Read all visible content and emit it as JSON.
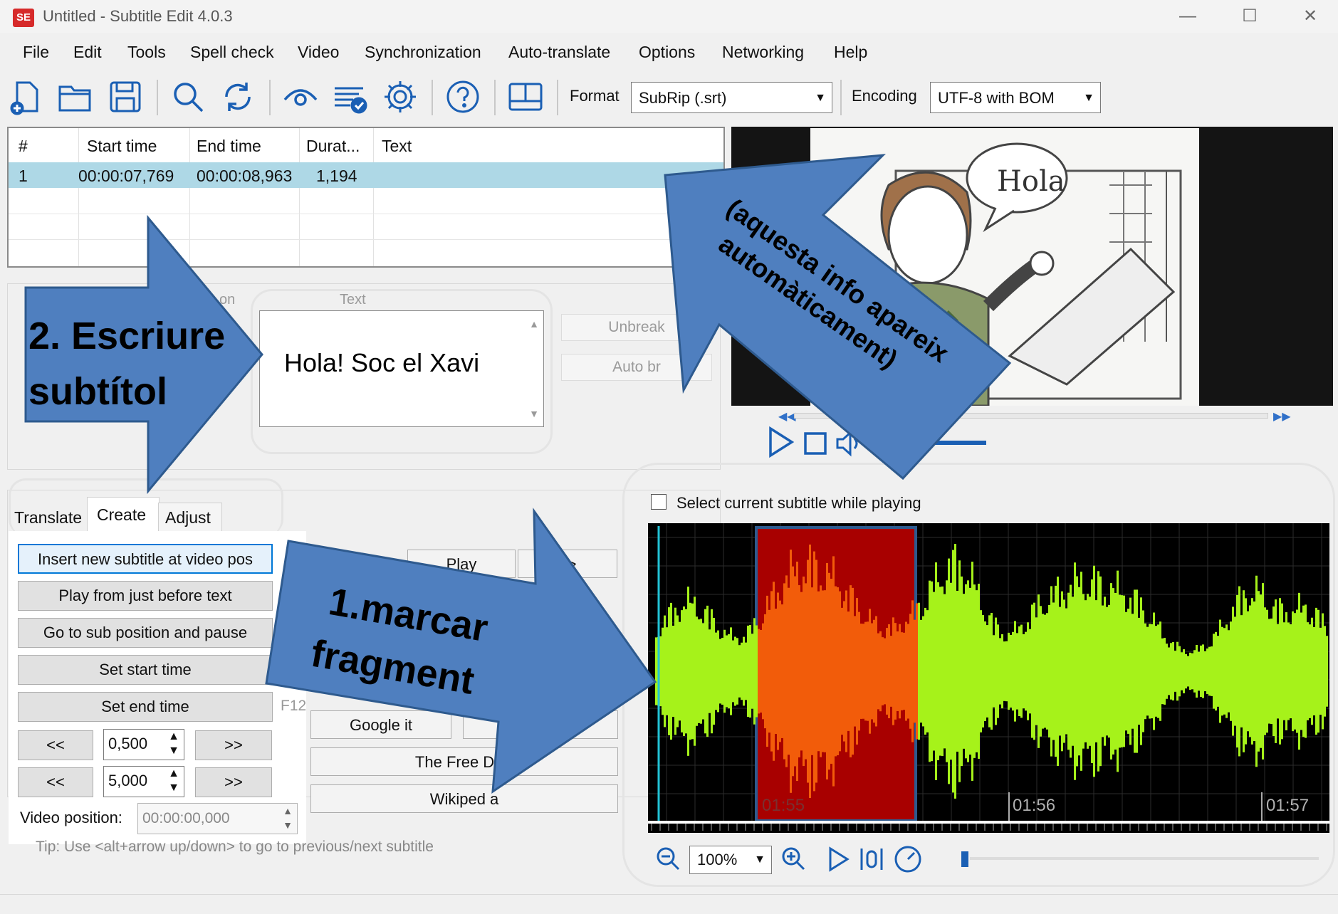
{
  "window": {
    "title": "Untitled - Subtitle Edit 4.0.3",
    "logo_text": "SE",
    "min_glyph": "—",
    "max_glyph": "☐",
    "close_glyph": "✕"
  },
  "menu": [
    "File",
    "Edit",
    "Tools",
    "Spell check",
    "Video",
    "Synchronization",
    "Auto-translate",
    "Options",
    "Networking",
    "Help"
  ],
  "toolbar": {
    "icons": [
      "new-file-icon",
      "open-folder-icon",
      "save-icon",
      "find-icon",
      "replace-icon",
      "visual-sync-icon",
      "spell-check-icon",
      "settings-icon",
      "help-icon",
      "layout-icon"
    ],
    "format_label": "Format",
    "format_value": "SubRip (.srt)",
    "encoding_label": "Encoding",
    "encoding_value": "UTF-8 with BOM"
  },
  "grid": {
    "headers": [
      "#",
      "Start time",
      "End time",
      "Durat...",
      "Text"
    ],
    "rows": [
      {
        "num": "1",
        "start": "00:00:07,769",
        "end": "00:00:08,963",
        "dur": "1,194",
        "text": ""
      }
    ]
  },
  "edit": {
    "duration_label_partial": "on",
    "text_label": "Text",
    "text_value": "Hola! Soc el Xavi",
    "unbreak_label": "Unbreak",
    "auto_br_label": "Auto br"
  },
  "video": {
    "speech_bubble": "Hola"
  },
  "tabs": {
    "items": [
      "Translate",
      "Create",
      "Adjust"
    ],
    "active": "Create"
  },
  "create": {
    "insert_new": "Insert new subtitle at video pos",
    "play_before": "Play from just before text",
    "goto_pause": "Go to sub position and pause",
    "set_start": "Set start time",
    "set_end": "Set end time",
    "shortcut_f12": "F12",
    "back_label": "<<",
    "fwd_label": ">>",
    "step1": "0,500",
    "step2": "5,000",
    "video_pos_label": "Video position:",
    "video_pos_value": "00:00:00,000"
  },
  "translate_area": {
    "play": "Play",
    "next_partial": "t >",
    "google_it": "Google it",
    "free_dict": "The Free Dicti",
    "wikipedia": "Wikiped a"
  },
  "tip": "Tip: Use <alt+arrow up/down> to go to previous/next subtitle",
  "waveform": {
    "checkbox_label": "Select current subtitle while playing",
    "time_labels": [
      "01:55",
      "01:56",
      "01:57"
    ],
    "zoom_value": "100%"
  },
  "callouts": {
    "write": [
      "2. Escriure",
      "subtítol"
    ],
    "mark": [
      "1.marcar",
      "fragment"
    ],
    "auto": [
      "(aquesta  info apareix",
      "automàticament)"
    ]
  },
  "colors": {
    "arrow_fill": "#4f7fbf",
    "arrow_stroke": "#2e5a8e",
    "wave_green": "#a6f21a",
    "wave_orange": "#f25c0a",
    "selection_red": "#a80000",
    "grid_selected_row": "#aed8e6"
  }
}
